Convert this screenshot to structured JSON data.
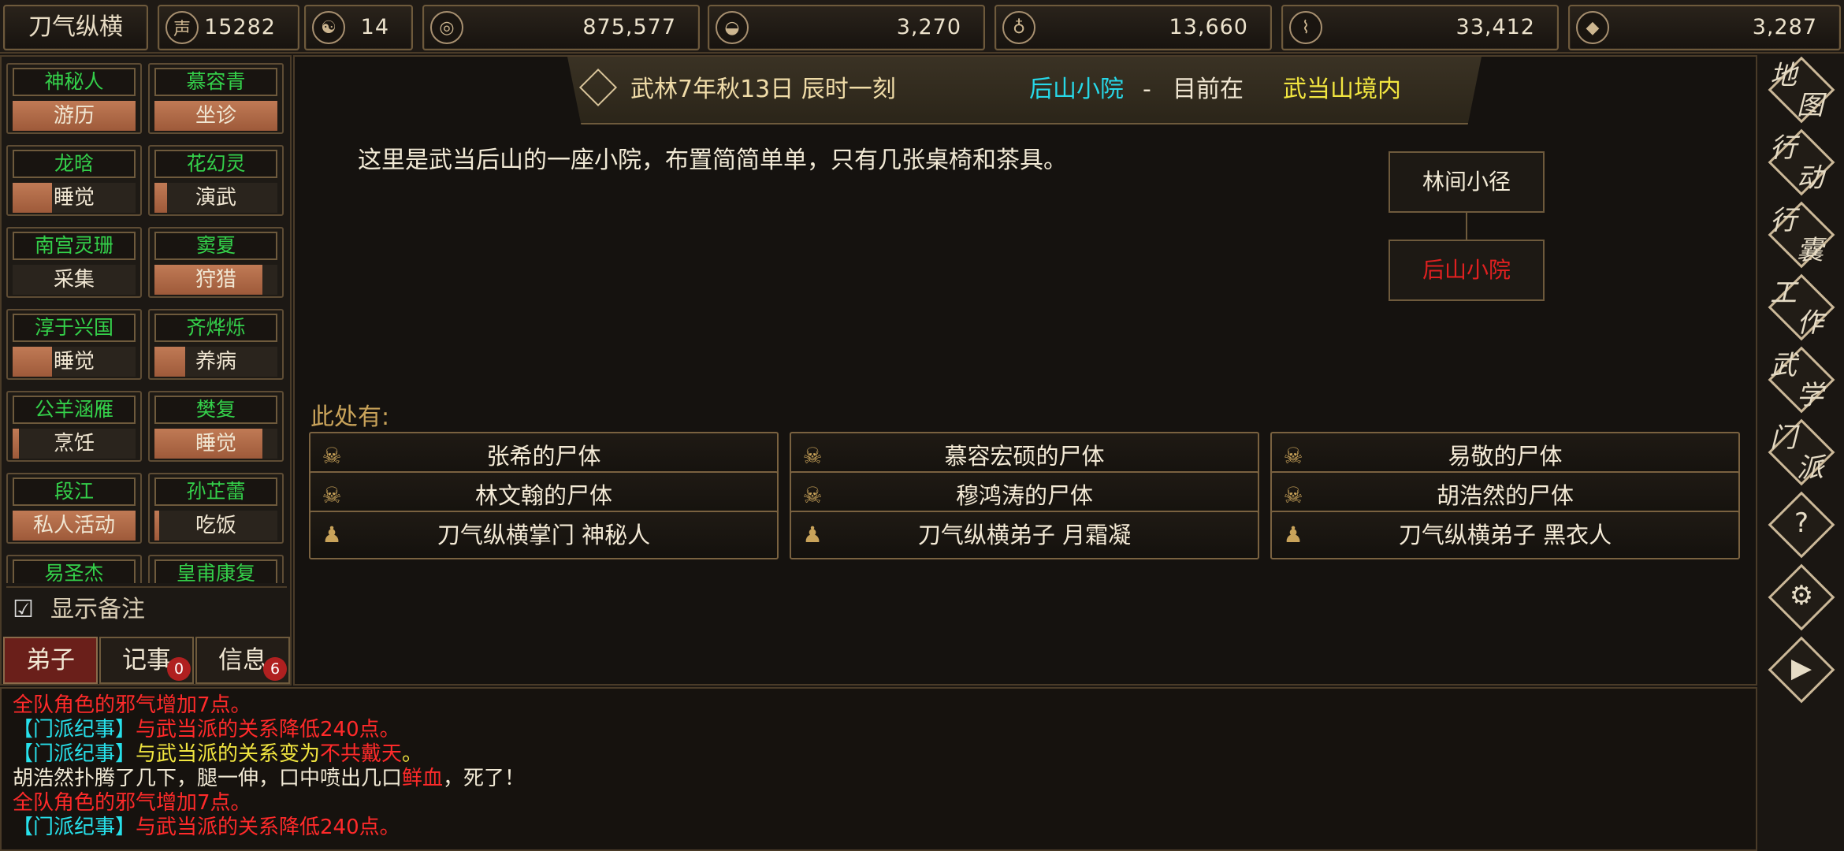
{
  "topbar": {
    "sect_name": "刀气纵横",
    "resources": [
      {
        "icon": "reputation-icon",
        "value": "15282"
      },
      {
        "icon": "yin-yang-icon",
        "value": "14"
      },
      {
        "icon": "coin-icon",
        "value": "875,577"
      },
      {
        "icon": "food-bowl-icon",
        "value": "3,270"
      },
      {
        "icon": "gourd-herb-icon",
        "value": "13,660"
      },
      {
        "icon": "wood-log-icon",
        "value": "33,412"
      },
      {
        "icon": "ore-stone-icon",
        "value": "3,287"
      }
    ]
  },
  "disciples": [
    {
      "name": "神秘人",
      "task": "游历",
      "progress": 1.0
    },
    {
      "name": "慕容青",
      "task": "坐诊",
      "progress": 1.0
    },
    {
      "name": "龙晗",
      "task": "睡觉",
      "progress": 0.32
    },
    {
      "name": "花幻灵",
      "task": "演武",
      "progress": 0.1
    },
    {
      "name": "南宫灵珊",
      "task": "采集",
      "progress": 0.0
    },
    {
      "name": "窦夏",
      "task": "狩猎",
      "progress": 0.88
    },
    {
      "name": "淳于兴国",
      "task": "睡觉",
      "progress": 0.32
    },
    {
      "name": "齐烨烁",
      "task": "养病",
      "progress": 0.25
    },
    {
      "name": "公羊涵雁",
      "task": "烹饪",
      "progress": 0.05
    },
    {
      "name": "樊复",
      "task": "睡觉",
      "progress": 0.88
    },
    {
      "name": "段江",
      "task": "私人活动",
      "progress": 1.0
    },
    {
      "name": "孙芷蕾",
      "task": "吃饭",
      "progress": 0.04
    },
    {
      "name": "易圣杰",
      "task": "",
      "progress": 0.0
    },
    {
      "name": "皇甫康复",
      "task": "",
      "progress": 0.0
    }
  ],
  "show_notes_label": "显示备注",
  "bottom_tabs": [
    {
      "label": "弟子",
      "badge": ""
    },
    {
      "label": "记事",
      "badge": "0"
    },
    {
      "label": "信息",
      "badge": "6"
    }
  ],
  "banner": {
    "time": "武林7年秋13日 辰时一刻",
    "location": "后山小院",
    "separator": "-",
    "prefix": "目前在",
    "region": "武当山境内"
  },
  "description": "这里是武当后山的一座小院，布置简简单单，只有几张桌椅和茶具。",
  "map": {
    "north": "林间小径",
    "current": "后山小院",
    "current_color": "#e02020"
  },
  "here_label": "此处有:",
  "entities": [
    {
      "icon": "skull-icon",
      "label": "张希的尸体"
    },
    {
      "icon": "skull-icon",
      "label": "慕容宏硕的尸体"
    },
    {
      "icon": "skull-icon",
      "label": "易敬的尸体"
    },
    {
      "icon": "skull-icon",
      "label": "林文翰的尸体"
    },
    {
      "icon": "skull-icon",
      "label": "穆鸿涛的尸体"
    },
    {
      "icon": "skull-icon",
      "label": "胡浩然的尸体"
    },
    {
      "icon": "person-icon",
      "label": "刀气纵横掌门 神秘人"
    },
    {
      "icon": "person-icon",
      "label": "刀气纵横弟子 月霜凝"
    },
    {
      "icon": "person-icon",
      "label": "刀气纵横弟子 黑衣人"
    }
  ],
  "right_menu": [
    {
      "c1": "地",
      "c2": "图"
    },
    {
      "c1": "行",
      "c2": "动"
    },
    {
      "c1": "行",
      "c2": "囊"
    },
    {
      "c1": "工",
      "c2": "作"
    },
    {
      "c1": "武",
      "c2": "学"
    },
    {
      "c1": "门",
      "c2": "派"
    },
    {
      "sym": "?"
    },
    {
      "sym": "⚙"
    },
    {
      "sym": "▶"
    }
  ],
  "log": [
    [
      {
        "t": "全队角色的邪气增加7点。",
        "c": "red"
      }
    ],
    [
      {
        "t": "【门派纪事】",
        "c": "cyan"
      },
      {
        "t": "与武当派的关系降低240点。",
        "c": "red"
      }
    ],
    [
      {
        "t": "【门派纪事】",
        "c": "cyan"
      },
      {
        "t": "与武当派的关系变为",
        "c": "yellow"
      },
      {
        "t": "不共戴天",
        "c": "red"
      },
      {
        "t": "。",
        "c": "yellow"
      }
    ],
    [
      {
        "t": "胡浩然扑腾了几下，腿一伸，口中喷出几口",
        "c": "white"
      },
      {
        "t": "鲜血",
        "c": "red"
      },
      {
        "t": "，死了！",
        "c": "white"
      }
    ],
    [
      {
        "t": "全队角色的邪气增加7点。",
        "c": "red"
      }
    ],
    [
      {
        "t": "【门派纪事】",
        "c": "cyan"
      },
      {
        "t": "与武当派的关系降低240点。",
        "c": "red"
      }
    ]
  ]
}
